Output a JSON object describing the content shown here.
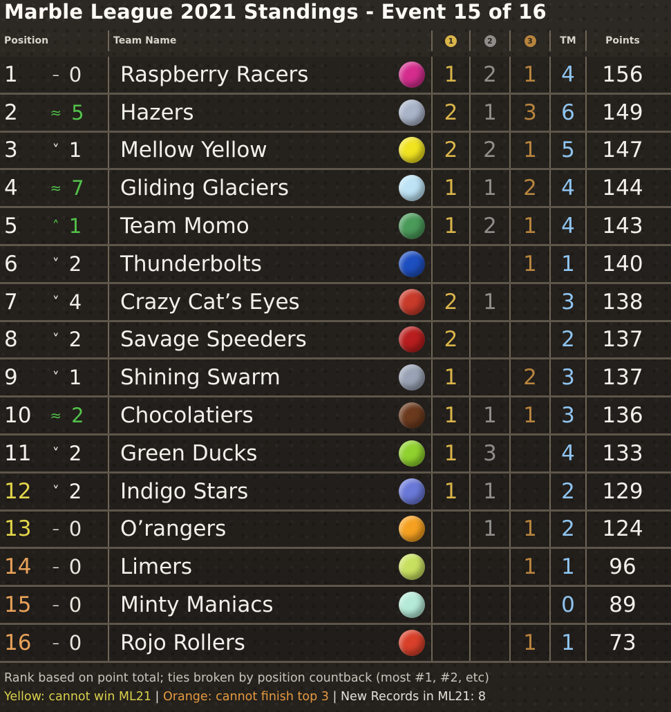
{
  "title": "Marble League 2021 Standings - Event 15 of 16",
  "headers": {
    "position": "Position",
    "team_name": "Team Name",
    "gold_medal": "1",
    "silver_medal": "2",
    "bronze_medal": "3",
    "tm": "TM",
    "points": "Points"
  },
  "colors": {
    "gold": "#d9b54a",
    "silver": "#8f8e8a",
    "bronze": "#b8843d",
    "tm": "#8fc4f0",
    "up": "#52c24a",
    "down": "#c92a1e",
    "cannot_win": "#e3d64a",
    "cannot_top3": "#e8a25a"
  },
  "rows": [
    {
      "pos": "1",
      "chg": "0",
      "dir": "same",
      "team": "Raspberry Racers",
      "marble": "#d42d8e",
      "g": "1",
      "s": "2",
      "b": "1",
      "tm": "4",
      "pts": "156",
      "status": ""
    },
    {
      "pos": "2",
      "chg": "5",
      "dir": "up",
      "team": "Hazers",
      "marble": "#a9b4c9",
      "g": "2",
      "s": "1",
      "b": "3",
      "tm": "6",
      "pts": "149",
      "status": ""
    },
    {
      "pos": "3",
      "chg": "1",
      "dir": "down",
      "team": "Mellow Yellow",
      "marble": "#f0e320",
      "g": "2",
      "s": "2",
      "b": "1",
      "tm": "5",
      "pts": "147",
      "status": ""
    },
    {
      "pos": "4",
      "chg": "7",
      "dir": "up",
      "team": "Gliding Glaciers",
      "marble": "#bde3f5",
      "g": "1",
      "s": "1",
      "b": "2",
      "tm": "4",
      "pts": "144",
      "status": ""
    },
    {
      "pos": "5",
      "chg": "1",
      "dir": "up",
      "team": "Team Momo",
      "marble": "#4a9a5a",
      "g": "1",
      "s": "2",
      "b": "1",
      "tm": "4",
      "pts": "143",
      "status": ""
    },
    {
      "pos": "6",
      "chg": "2",
      "dir": "down",
      "team": "Thunderbolts",
      "marble": "#1e4fc0",
      "g": "",
      "s": "",
      "b": "1",
      "tm": "1",
      "pts": "140",
      "status": ""
    },
    {
      "pos": "7",
      "chg": "4",
      "dir": "down",
      "team": "Crazy Cat’s Eyes",
      "marble": "#c83a2a",
      "g": "2",
      "s": "1",
      "b": "",
      "tm": "3",
      "pts": "138",
      "status": ""
    },
    {
      "pos": "8",
      "chg": "2",
      "dir": "down",
      "team": "Savage Speeders",
      "marble": "#b81e1e",
      "g": "2",
      "s": "",
      "b": "",
      "tm": "2",
      "pts": "137",
      "status": ""
    },
    {
      "pos": "9",
      "chg": "1",
      "dir": "down",
      "team": "Shining Swarm",
      "marble": "#9aa3b5",
      "g": "1",
      "s": "",
      "b": "2",
      "tm": "3",
      "pts": "137",
      "status": ""
    },
    {
      "pos": "10",
      "chg": "2",
      "dir": "up",
      "team": "Chocolatiers",
      "marble": "#6b3a1e",
      "g": "1",
      "s": "1",
      "b": "1",
      "tm": "3",
      "pts": "136",
      "status": ""
    },
    {
      "pos": "11",
      "chg": "2",
      "dir": "down",
      "team": "Green Ducks",
      "marble": "#8fd12e",
      "g": "1",
      "s": "3",
      "b": "",
      "tm": "4",
      "pts": "133",
      "status": ""
    },
    {
      "pos": "12",
      "chg": "2",
      "dir": "down",
      "team": "Indigo Stars",
      "marble": "#6a78d8",
      "g": "1",
      "s": "1",
      "b": "",
      "tm": "2",
      "pts": "129",
      "status": "yellow"
    },
    {
      "pos": "13",
      "chg": "0",
      "dir": "same",
      "team": "O’rangers",
      "marble": "#f5a020",
      "g": "",
      "s": "1",
      "b": "1",
      "tm": "2",
      "pts": "124",
      "status": "yellow"
    },
    {
      "pos": "14",
      "chg": "0",
      "dir": "same",
      "team": "Limers",
      "marble": "#c8e060",
      "g": "",
      "s": "",
      "b": "1",
      "tm": "1",
      "pts": "96",
      "status": "orange"
    },
    {
      "pos": "15",
      "chg": "0",
      "dir": "same",
      "team": "Minty Maniacs",
      "marble": "#b5ead8",
      "g": "",
      "s": "",
      "b": "",
      "tm": "0",
      "pts": "89",
      "status": "orange"
    },
    {
      "pos": "16",
      "chg": "0",
      "dir": "same",
      "team": "Rojo Rollers",
      "marble": "#d8402a",
      "g": "",
      "s": "",
      "b": "1",
      "tm": "1",
      "pts": "73",
      "status": "orange"
    }
  ],
  "footer": {
    "line1": "Rank based on point total; ties broken by position countback (most #1, #2, etc)",
    "yellow_note": "Yellow: cannot win ML21",
    "sep1": " | ",
    "orange_note": "Orange: cannot finish top 3",
    "sep2": " | ",
    "records_note": "New Records in ML21: 8"
  }
}
